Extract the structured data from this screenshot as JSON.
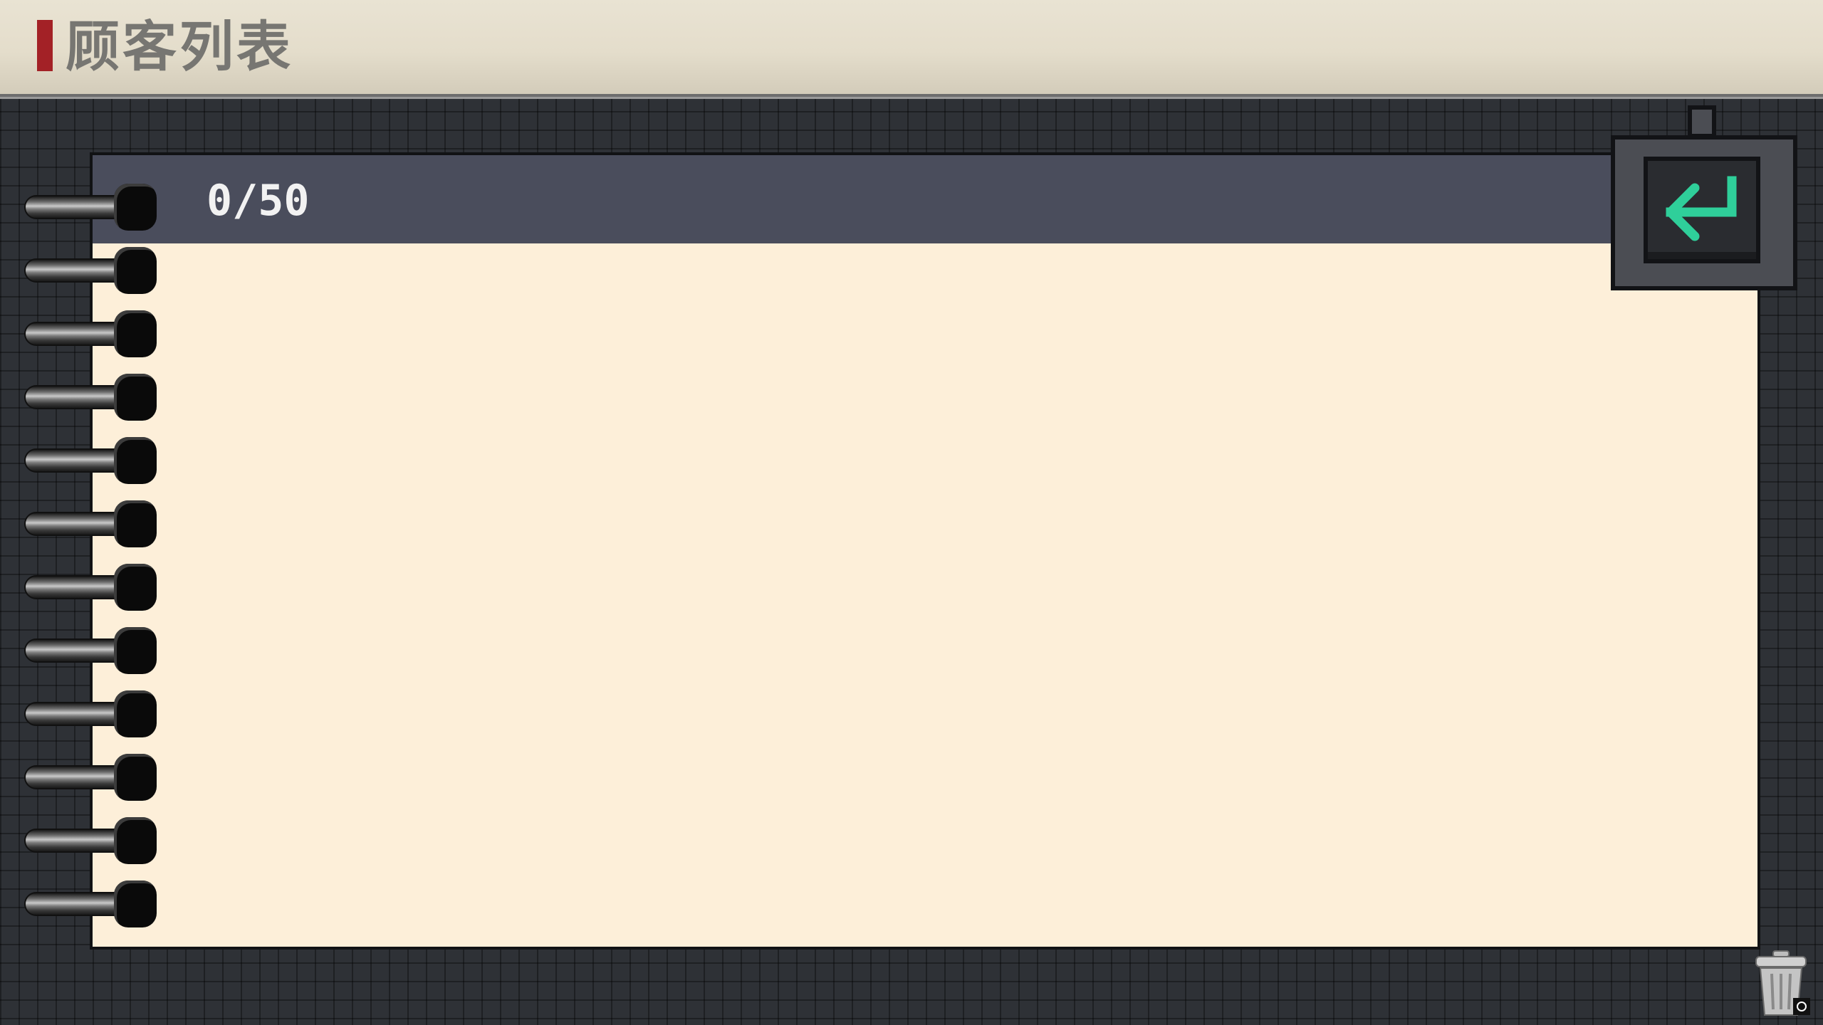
{
  "header": {
    "title": "顾客列表",
    "accent_color": "#a32126"
  },
  "customer_list": {
    "count": "0/50",
    "items": []
  },
  "icons": {
    "back": "return-arrow-icon",
    "trash": "trash-can-icon",
    "back_color": "#2fcf9a"
  }
}
